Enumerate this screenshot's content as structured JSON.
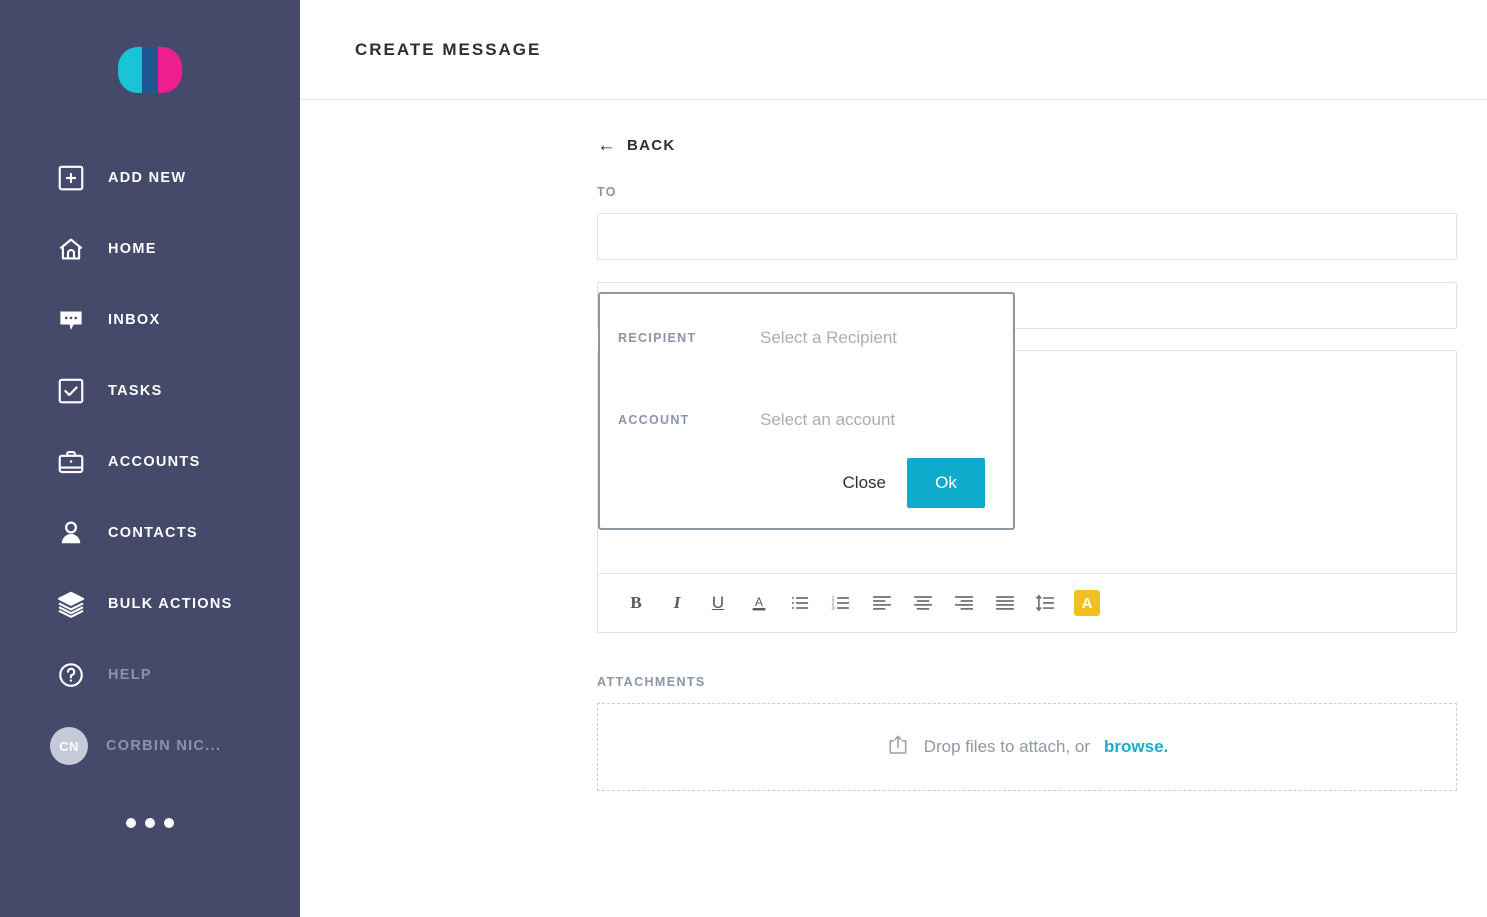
{
  "sidebar": {
    "logo": {
      "name": "app-logo",
      "color_left": "#19c4d6",
      "color_right": "#ec1e90",
      "color_overlap": "#1c5792"
    },
    "background_color": "#454a6b",
    "items": [
      {
        "label": "ADD NEW",
        "icon": "plus-square-icon",
        "state": "active"
      },
      {
        "label": "HOME",
        "icon": "home-icon",
        "state": "active"
      },
      {
        "label": "INBOX",
        "icon": "chat-bubble-icon",
        "state": "active"
      },
      {
        "label": "TASKS",
        "icon": "check-square-icon",
        "state": "active"
      },
      {
        "label": "ACCOUNTS",
        "icon": "briefcase-icon",
        "state": "active"
      },
      {
        "label": "CONTACTS",
        "icon": "person-icon",
        "state": "active"
      },
      {
        "label": "BULK ACTIONS",
        "icon": "layers-icon",
        "state": "active"
      },
      {
        "label": "HELP",
        "icon": "question-circle-icon",
        "state": "dimmed"
      }
    ],
    "user": {
      "initials": "CN",
      "name": "CORBIN NIC...",
      "avatar_color": "#c6cad8"
    },
    "more_menu": "more-dots"
  },
  "header": {
    "title": "CREATE MESSAGE"
  },
  "content": {
    "back": {
      "label": "BACK",
      "arrow": "←"
    },
    "to": {
      "label": "TO",
      "value": "",
      "placeholder": ""
    },
    "field2": {
      "value": "",
      "placeholder": ""
    },
    "body": {
      "value": "",
      "placeholder": ""
    },
    "attachments": {
      "label": "ATTACHMENTS",
      "drop_text": "Drop files to attach, or",
      "browse_label": "browse.",
      "icon": "upload-icon",
      "link_color": "#19aecd"
    },
    "toolbar": {
      "buttons": [
        {
          "name": "bold-button",
          "glyph": "B"
        },
        {
          "name": "italic-button",
          "glyph": "I"
        },
        {
          "name": "underline-button",
          "glyph": "U"
        },
        {
          "name": "text-color-button",
          "glyph": "A"
        },
        {
          "name": "bullet-list-button",
          "glyph": ""
        },
        {
          "name": "numbered-list-button",
          "glyph": ""
        },
        {
          "name": "align-left-button",
          "glyph": ""
        },
        {
          "name": "align-center-button",
          "glyph": ""
        },
        {
          "name": "align-right-button",
          "glyph": ""
        },
        {
          "name": "align-justify-button",
          "glyph": ""
        },
        {
          "name": "line-height-button",
          "glyph": ""
        },
        {
          "name": "highlight-button",
          "glyph": "A",
          "background": "#efc01e"
        }
      ]
    }
  },
  "modal": {
    "recipient": {
      "label": "RECIPIENT",
      "value": "Select a Recipient"
    },
    "account": {
      "label": "ACCOUNT",
      "value": "Select an account"
    },
    "close_label": "Close",
    "ok_label": "Ok",
    "ok_color": "#0fabcc",
    "border_color": "#8b99a7"
  }
}
